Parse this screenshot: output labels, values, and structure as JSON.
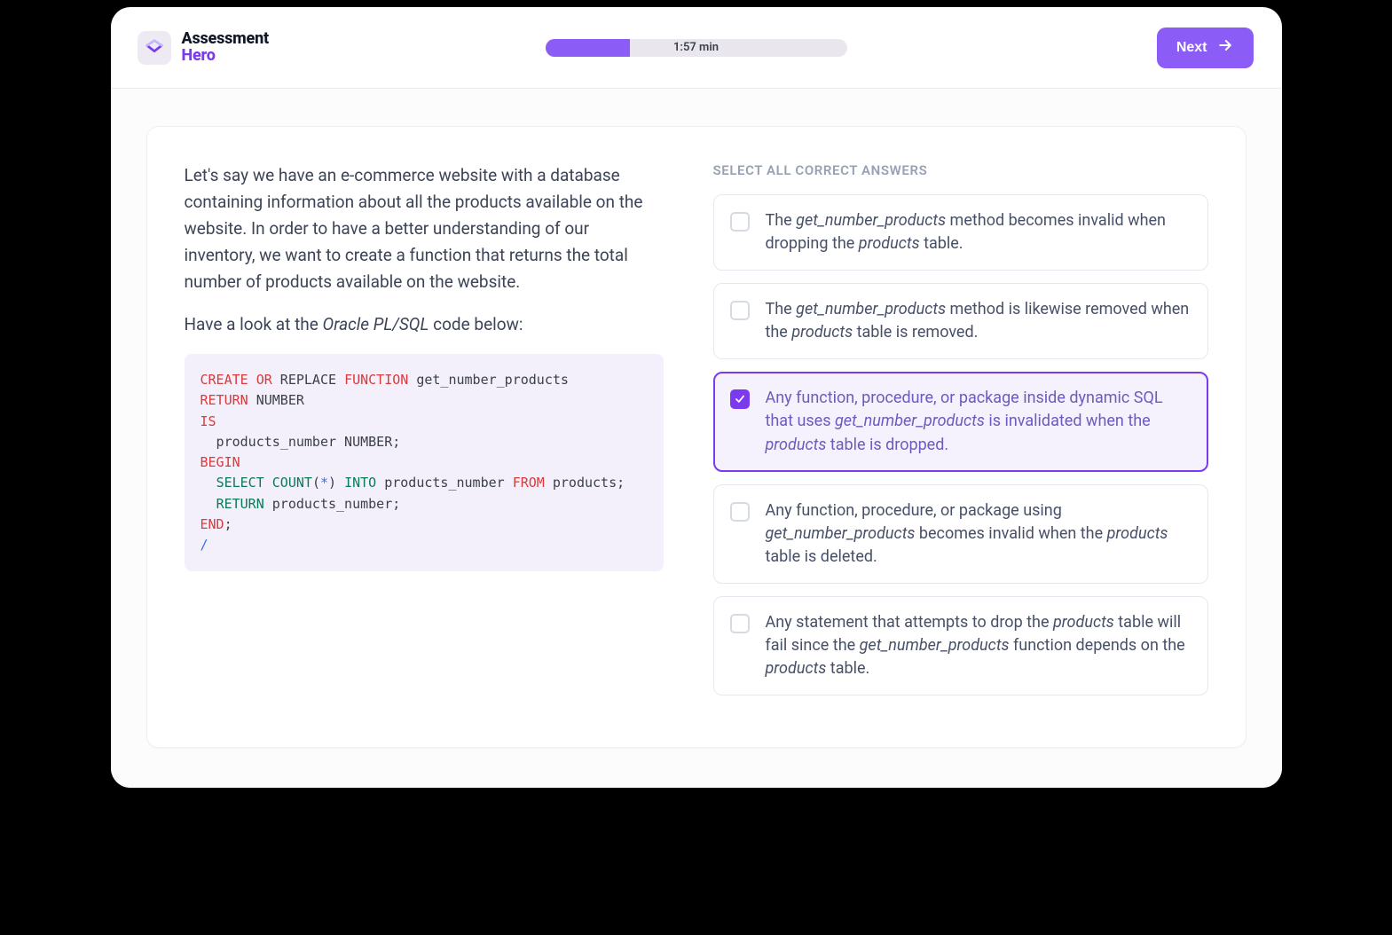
{
  "brand": {
    "line1": "Assessment",
    "line2": "Hero"
  },
  "progress": {
    "label": "1:57 min",
    "fill_percent": 28
  },
  "next_button": {
    "label": "Next"
  },
  "question": {
    "para1": "Let's say we have an e-commerce website with a database containing information about all the products available on the website. In order to have a better understanding of our inventory, we want to create a function that returns the total number of products available on the website.",
    "para2_pre": "Have a look at the ",
    "para2_em": "Oracle PL/SQL",
    "para2_post": " code below:"
  },
  "code": {
    "tokens": [
      {
        "t": "CREATE",
        "c": "kw"
      },
      {
        "t": " "
      },
      {
        "t": "OR",
        "c": "kw"
      },
      {
        "t": " REPLACE "
      },
      {
        "t": "FUNCTION",
        "c": "kw"
      },
      {
        "t": " get_number_products\n"
      },
      {
        "t": "RETURN",
        "c": "kw"
      },
      {
        "t": " NUMBER\n"
      },
      {
        "t": "IS",
        "c": "kw"
      },
      {
        "t": "\n"
      },
      {
        "t": "  products_number NUMBER;\n"
      },
      {
        "t": "BEGIN",
        "c": "kw"
      },
      {
        "t": "\n"
      },
      {
        "t": "  "
      },
      {
        "t": "SELECT",
        "c": "fn"
      },
      {
        "t": " "
      },
      {
        "t": "COUNT",
        "c": "fn"
      },
      {
        "t": "("
      },
      {
        "t": "*",
        "c": "op"
      },
      {
        "t": ") "
      },
      {
        "t": "INTO",
        "c": "fn"
      },
      {
        "t": " products_number "
      },
      {
        "t": "FROM",
        "c": "kw"
      },
      {
        "t": " products;\n"
      },
      {
        "t": "  "
      },
      {
        "t": "RETURN",
        "c": "fn"
      },
      {
        "t": " products_number;\n"
      },
      {
        "t": "END",
        "c": "kw"
      },
      {
        "t": ";\n"
      },
      {
        "t": "/",
        "c": "op"
      }
    ]
  },
  "instruction": "SELECT ALL CORRECT ANSWERS",
  "answers": [
    {
      "selected": false,
      "parts": [
        {
          "t": "The "
        },
        {
          "t": "get_number_products",
          "em": true
        },
        {
          "t": " method becomes invalid when dropping the "
        },
        {
          "t": "products",
          "em": true
        },
        {
          "t": " table."
        }
      ]
    },
    {
      "selected": false,
      "parts": [
        {
          "t": "The "
        },
        {
          "t": "get_number_products",
          "em": true
        },
        {
          "t": " method is likewise removed when the "
        },
        {
          "t": "products",
          "em": true
        },
        {
          "t": " table is removed."
        }
      ]
    },
    {
      "selected": true,
      "parts": [
        {
          "t": "Any function, procedure, or package inside dynamic SQL that uses "
        },
        {
          "t": "get_number_products",
          "em": true
        },
        {
          "t": " is invalidated when the "
        },
        {
          "t": "products",
          "em": true
        },
        {
          "t": " table is dropped."
        }
      ]
    },
    {
      "selected": false,
      "parts": [
        {
          "t": "Any function, procedure, or package using "
        },
        {
          "t": "get_number_products",
          "em": true
        },
        {
          "t": " becomes invalid when the "
        },
        {
          "t": "products",
          "em": true
        },
        {
          "t": " table is deleted."
        }
      ]
    },
    {
      "selected": false,
      "parts": [
        {
          "t": "Any statement that attempts to drop the "
        },
        {
          "t": "products",
          "em": true
        },
        {
          "t": " table will fail since the "
        },
        {
          "t": "get_number_products",
          "em": true
        },
        {
          "t": " function depends on the "
        },
        {
          "t": "products",
          "em": true
        },
        {
          "t": " table."
        }
      ]
    }
  ]
}
